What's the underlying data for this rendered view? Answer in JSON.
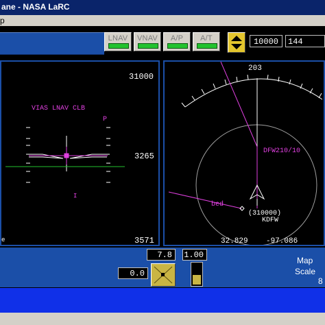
{
  "window": {
    "title": "ane - NASA LaRC"
  },
  "menu": {
    "label": "p"
  },
  "mode_buttons": [
    {
      "label": "LNAV",
      "status_color": "#22c22e"
    },
    {
      "label": "VNAV",
      "status_color": "#22c22e"
    },
    {
      "label": "A/P",
      "status_color": "#22c22e"
    },
    {
      "label": "A/T",
      "status_color": "#22c22e"
    }
  ],
  "altitude_select": {
    "value": "10000"
  },
  "speed_select": {
    "value": "144"
  },
  "pfd": {
    "mode_annunciation": "VIAS LNAV CLB",
    "mode_suffix": "P",
    "altitude_top": "31000",
    "altitude_current": "3265",
    "altitude_bottom": "3571",
    "bottom_left_mark": "e",
    "speed_marker": "I"
  },
  "nd": {
    "heading": "203",
    "waypoint_label": "DFW210/10",
    "label_bed": "bed",
    "label_altitude": "(310000)",
    "label_kdfw": "KDFW",
    "latitude": "32.829",
    "longitude": "-97.086"
  },
  "controls": {
    "value_top": "7.8",
    "value_right": "1.00",
    "value_left": "0.0",
    "throttle_level": 0.45,
    "map_label": "Map",
    "scale_label": "Scale",
    "scale_value": "8"
  },
  "colors": {
    "magenta": "#e040e0",
    "green": "#22c22e",
    "panel_blue": "#1b4fa8",
    "bottom_blue": "#1030e8"
  }
}
